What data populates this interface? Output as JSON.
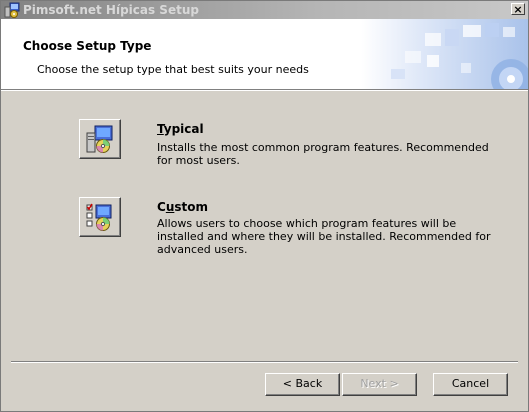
{
  "window": {
    "title": "Pimsoft.net Hípicas Setup",
    "close_glyph": "×"
  },
  "banner": {
    "title": "Choose Setup Type",
    "subtitle": "Choose the setup type that best suits your needs"
  },
  "options": [
    {
      "mnemonic": "T",
      "title_rest": "ypical",
      "description": "Installs the most common program features. Recommended for most users.",
      "icon": "computer-cd-icon"
    },
    {
      "title_start": "C",
      "mnemonic": "u",
      "title_rest": "stom",
      "description": "Allows users to choose which program features will be installed and where they will be installed. Recommended for advanced users.",
      "icon": "custom-checklist-cd-icon"
    }
  ],
  "buttons": {
    "back": "< Back",
    "next": "Next >",
    "cancel": "Cancel"
  },
  "colors": {
    "titlebar_start": "#828282",
    "titlebar_end": "#c8c8c8",
    "dialog_face": "#d4d0c8",
    "banner_accent": "#a9c2ea"
  }
}
